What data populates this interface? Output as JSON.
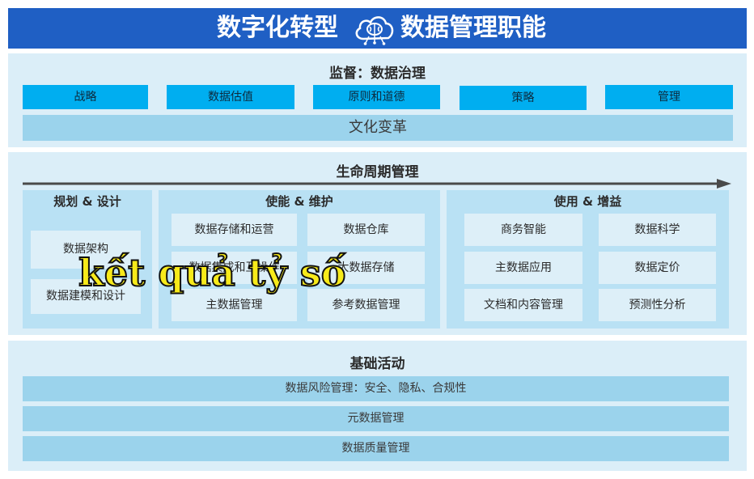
{
  "header": {
    "title_left": "数字化转型",
    "title_right": "数据管理职能",
    "icon": "cloud-brain-icon"
  },
  "governance": {
    "title": "监督：数据治理",
    "items": [
      "战略",
      "数据估值",
      "原则和道德",
      "策略",
      "管理"
    ],
    "culture": "文化变革"
  },
  "lifecycle": {
    "title": "生命周期管理",
    "arrow_icon": "right-arrow-icon",
    "plan": {
      "title": "规划 & 设计",
      "items": [
        "数据架构",
        "数据建模和设计"
      ]
    },
    "enable": {
      "title": "使能 & 维护",
      "items": [
        "数据存储和运营",
        "数据仓库",
        "数据集成和互操作",
        "大数据存储",
        "主数据管理",
        "参考数据管理"
      ]
    },
    "use": {
      "title": "使用 & 增益",
      "items": [
        "商务智能",
        "数据科学",
        "主数据应用",
        "数据定价",
        "文档和内容管理",
        "预测性分析"
      ]
    }
  },
  "foundation": {
    "title": "基础活动",
    "items": [
      "数据风险管理：安全、隐私、合规性",
      "元数据管理",
      "数据质量管理"
    ]
  },
  "overlay_text": "kết quả tỷ số",
  "colors": {
    "header_bg": "#1f5fc4",
    "panel_bg": "#dbeef8",
    "governance_box": "#00aef0",
    "bar": "#9bd3ec",
    "sub_panel": "#b9e1f4",
    "cell": "#ddeff8",
    "overlay_text": "#f7ea1a"
  }
}
